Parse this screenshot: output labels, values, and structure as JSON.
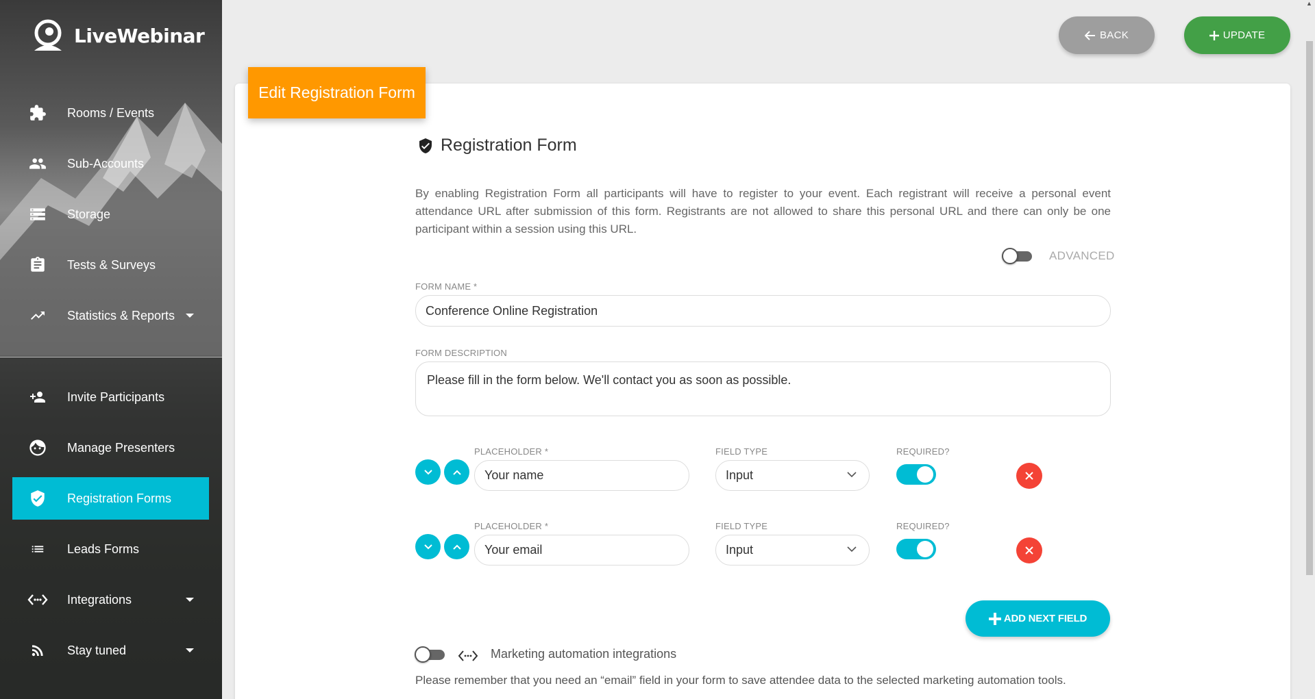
{
  "app": {
    "name": "LiveWebinar"
  },
  "sidebar": {
    "items": [
      {
        "label": "Rooms / Events",
        "icon": "puzzle-icon"
      },
      {
        "label": "Sub-Accounts",
        "icon": "people-icon"
      },
      {
        "label": "Storage",
        "icon": "storage-icon"
      },
      {
        "label": "Tests & Surveys",
        "icon": "clipboard-icon"
      },
      {
        "label": "Statistics & Reports",
        "icon": "trending-up-icon"
      },
      {
        "label": "Invite Participants",
        "icon": "person-add-icon"
      },
      {
        "label": "Manage Presenters",
        "icon": "face-icon"
      },
      {
        "label": "Registration Forms",
        "icon": "shield-check-icon",
        "active": true
      },
      {
        "label": "Leads Forms",
        "icon": "list-icon"
      },
      {
        "label": "Integrations",
        "icon": "code-arrows-icon"
      },
      {
        "label": "Stay tuned",
        "icon": "rss-icon"
      }
    ]
  },
  "header": {
    "back_label": "BACK",
    "update_label": "UPDATE"
  },
  "card": {
    "tag": "Edit Registration Form",
    "section_title": "Registration Form",
    "intro": "By enabling Registration Form all participants will have to register to your event. Each registrant will receive a personal event attendance URL after submission of this form. Registrants are not allowed to share this personal URL and there can only be one participant within a session using this URL.",
    "advanced_label": "ADVANCED",
    "form_name_label": "FORM NAME *",
    "form_name_value": "Conference Online Registration",
    "form_description_label": "FORM DESCRIPTION",
    "form_description_value": "Please fill in the form below. We'll contact you as soon as possible.",
    "fields": [
      {
        "placeholder_label": "PLACEHOLDER *",
        "placeholder_value": "Your name",
        "type_label": "FIELD TYPE",
        "type_value": "Input",
        "required_label": "REQUIRED?",
        "required": true
      },
      {
        "placeholder_label": "PLACEHOLDER *",
        "placeholder_value": "Your email",
        "type_label": "FIELD TYPE",
        "type_value": "Input",
        "required_label": "REQUIRED?",
        "required": true
      }
    ],
    "add_field_label": "ADD NEXT FIELD",
    "marketing_label": "Marketing automation integrations",
    "marketing_note": "Please remember that you need an “email” field in your form to save attendee data to the selected marketing automation tools."
  },
  "colors": {
    "accent": "#00bcd4",
    "orange": "#ff9800",
    "green": "#43a047",
    "grey": "#9e9e9e",
    "danger": "#f44336"
  }
}
